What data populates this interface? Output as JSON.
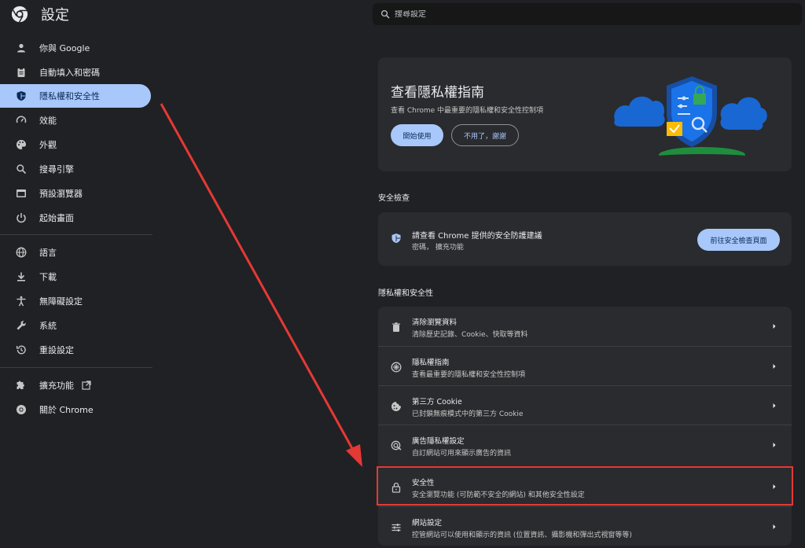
{
  "app": {
    "title": "設定"
  },
  "sidebar": {
    "items": [
      {
        "label": "你與 Google",
        "icon": "person-icon"
      },
      {
        "label": "自動填入和密碼",
        "icon": "clipboard-icon"
      },
      {
        "label": "隱私權和安全性",
        "icon": "shield-icon",
        "active": true
      },
      {
        "label": "效能",
        "icon": "gauge-icon"
      },
      {
        "label": "外觀",
        "icon": "palette-icon"
      },
      {
        "label": "搜尋引擎",
        "icon": "search-icon"
      },
      {
        "label": "預設瀏覽器",
        "icon": "browser-icon"
      },
      {
        "label": "起始畫面",
        "icon": "power-icon"
      },
      {
        "label": "語言",
        "icon": "globe-icon"
      },
      {
        "label": "下載",
        "icon": "download-icon"
      },
      {
        "label": "無障礙設定",
        "icon": "accessibility-icon"
      },
      {
        "label": "系統",
        "icon": "wrench-icon"
      },
      {
        "label": "重設設定",
        "icon": "history-icon"
      },
      {
        "label": "擴充功能",
        "icon": "puzzle-icon"
      },
      {
        "label": "關於 Chrome",
        "icon": "chrome-icon"
      }
    ]
  },
  "search": {
    "placeholder": "搜尋設定"
  },
  "promo": {
    "title": "查看隱私權指南",
    "subtitle": "查看 Chrome 中最重要的隱私權和安全性控制項",
    "primary_label": "開始使用",
    "secondary_label": "不用了，謝謝"
  },
  "safety_check": {
    "section_title": "安全檢查",
    "title": "請查看 Chrome 提供的安全防護建議",
    "subtitle": "密碼， 擴充功能",
    "button_label": "前往安全檢查頁面"
  },
  "privacy": {
    "section_title": "隱私權和安全性",
    "rows": [
      {
        "title": "清除瀏覽資料",
        "subtitle": "清除歷史記錄、Cookie、快取等資料",
        "icon": "trash-icon"
      },
      {
        "title": "隱私權指南",
        "subtitle": "查看最重要的隱私權和安全性控制項",
        "icon": "compass-icon"
      },
      {
        "title": "第三方 Cookie",
        "subtitle": "已封鎖無痕模式中的第三方 Cookie",
        "icon": "cookie-icon"
      },
      {
        "title": "廣告隱私權設定",
        "subtitle": "自訂網站可用來顯示廣告的資訊",
        "icon": "ad-privacy-icon"
      },
      {
        "title": "安全性",
        "subtitle": "安全瀏覽功能 (可防範不安全的網站) 和其他安全性設定",
        "icon": "lock-icon"
      },
      {
        "title": "網站設定",
        "subtitle": "控管網站可以使用和顯示的資訊 (位置資訊、攝影機和彈出式視窗等等)",
        "icon": "sliders-icon"
      }
    ]
  },
  "colors": {
    "accent": "#a8c7fa",
    "highlight": "#e53935",
    "background": "#202124",
    "card": "#2a2b2e"
  }
}
